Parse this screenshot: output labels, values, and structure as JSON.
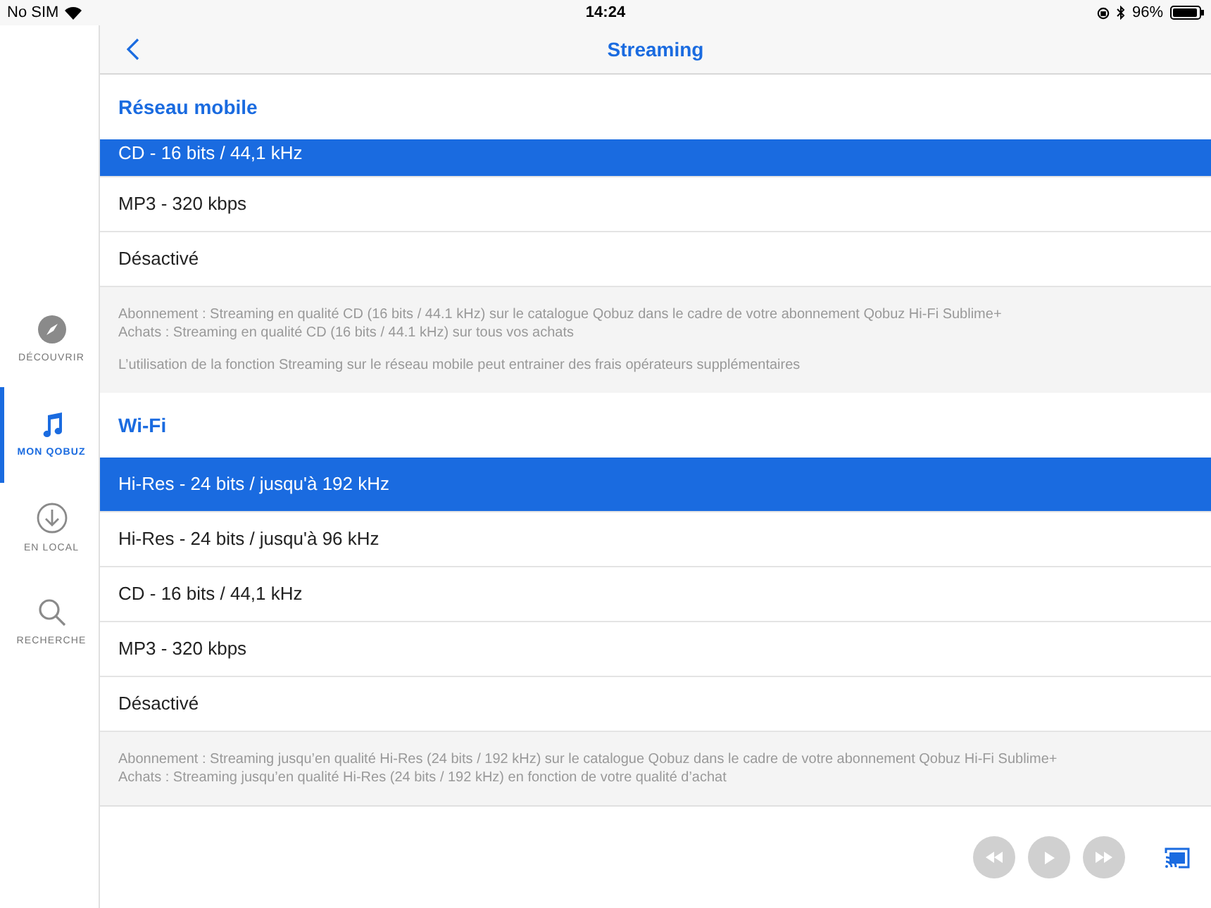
{
  "status_bar": {
    "carrier": "No SIM",
    "time": "14:24",
    "battery": "96%"
  },
  "sidebar": {
    "items": [
      {
        "kind": "compass",
        "label": "DÉCOUVRIR",
        "selected": false
      },
      {
        "kind": "music",
        "label": "MON QOBUZ",
        "selected": true
      },
      {
        "kind": "download",
        "label": "EN LOCAL",
        "selected": false
      },
      {
        "kind": "search",
        "label": "RECHERCHE",
        "selected": false
      }
    ]
  },
  "header": {
    "title": "Streaming"
  },
  "sections": [
    {
      "title": "Réseau mobile",
      "clipped_first": true,
      "options": [
        {
          "label": "CD - 16 bits / 44,1 kHz",
          "selected": true
        },
        {
          "label": "MP3 - 320 kbps",
          "selected": false
        },
        {
          "label": "Désactivé",
          "selected": false
        }
      ],
      "note": [
        [
          "Abonnement : Streaming en qualité CD (16 bits / 44.1 kHz) sur le catalogue Qobuz dans le cadre de votre abonnement Qobuz Hi-Fi Sublime+",
          "Achats : Streaming en qualité CD (16 bits / 44.1 kHz) sur tous vos achats"
        ],
        [
          "L’utilisation de la fonction Streaming sur le réseau mobile peut entrainer des frais opérateurs supplémentaires"
        ]
      ]
    },
    {
      "title": "Wi-Fi",
      "clipped_first": false,
      "options": [
        {
          "label": "Hi-Res - 24 bits / jusqu'à 192 kHz",
          "selected": true
        },
        {
          "label": "Hi-Res - 24 bits / jusqu'à 96 kHz",
          "selected": false
        },
        {
          "label": "CD - 16 bits / 44,1 kHz",
          "selected": false
        },
        {
          "label": "MP3 - 320 kbps",
          "selected": false
        },
        {
          "label": "Désactivé",
          "selected": false
        }
      ],
      "note": [
        [
          "Abonnement : Streaming jusqu’en qualité Hi-Res (24 bits / 192 kHz) sur le catalogue Qobuz dans le cadre de votre abonnement Qobuz Hi-Fi Sublime+",
          "Achats : Streaming jusqu’en qualité Hi-Res (24 bits / 192 kHz) en fonction de votre qualité d’achat"
        ]
      ]
    }
  ],
  "player": {
    "controls": [
      {
        "kind": "rewind",
        "disabled": true
      },
      {
        "kind": "play",
        "disabled": true
      },
      {
        "kind": "forward",
        "disabled": true
      }
    ]
  }
}
